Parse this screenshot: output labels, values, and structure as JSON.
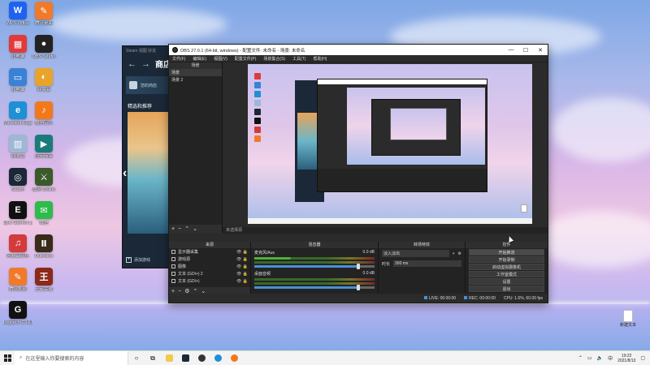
{
  "desktop": {
    "icons": [
      {
        "label": "WPS Office",
        "color": "#1f62f2",
        "glyph": "W"
      },
      {
        "label": "腾讯桌面",
        "color": "#f07a2a",
        "glyph": "✎"
      },
      {
        "label": "此电脑",
        "color": "#e23a3a",
        "glyph": "▦"
      },
      {
        "label": "OBS Studio",
        "color": "#222222",
        "glyph": "●"
      },
      {
        "label": "此电脑",
        "color": "#3a82d6",
        "glyph": "▭"
      },
      {
        "label": "网易云",
        "color": "#e8a42a",
        "glyph": "◐"
      },
      {
        "label": "Microsoft Edge",
        "color": "#1e90d6",
        "glyph": "e"
      },
      {
        "label": "酷狗音乐",
        "color": "#f2791a",
        "glyph": "♪"
      },
      {
        "label": "回收站",
        "color": "#9fb7d6",
        "glyph": "▥"
      },
      {
        "label": "应用商店",
        "color": "#1b7a7a",
        "glyph": "▶"
      },
      {
        "label": "Steam",
        "color": "#1b2838",
        "glyph": "◎"
      },
      {
        "label": "战网 Online",
        "color": "#3a5a2a",
        "glyph": "⚔"
      },
      {
        "label": "Epic Games Launcher",
        "color": "#111111",
        "glyph": "E"
      },
      {
        "label": "微信",
        "color": "#2dbb4b",
        "glyph": "✉"
      },
      {
        "label": "网易云音乐",
        "color": "#d33a3a",
        "glyph": "♫"
      },
      {
        "label": "Outriders",
        "color": "#3a2a1a",
        "glyph": "Ⅱ"
      },
      {
        "label": "腾讯视频",
        "color": "#f07a2a",
        "glyph": "✎"
      },
      {
        "label": "王者荣耀",
        "color": "#8a2a1a",
        "glyph": "王"
      },
      {
        "label": "Logitech G HUB",
        "color": "#111111",
        "glyph": "G"
      }
    ],
    "file_label": "新建文本"
  },
  "steam": {
    "top_text": "Steam  视图  好友",
    "store_label": "商店",
    "banner_text": "您的商店",
    "featured_label": "精选和推荐",
    "add_game_label": "添加游戏"
  },
  "obs": {
    "title": "OBS 27.0.1 (64-bit, windows) - 配置文件: 未命名 - 场景: 未命名",
    "menu": [
      "文件(F)",
      "编辑(E)",
      "视图(V)",
      "配置文件(P)",
      "场景集合(S)",
      "工具(T)",
      "帮助(H)"
    ],
    "scenes_header": "场景",
    "scenes": [
      "场景",
      "场景 2"
    ],
    "source_toolbar": "未选择源",
    "docks": {
      "sources": "来源",
      "mixer": "混音器",
      "transitions": "转场特效",
      "controls": "控件"
    },
    "sources": [
      "显示器采集",
      "游戏源",
      "图像",
      "文本 (GDI+) 2",
      "文本 (GDI+)"
    ],
    "mixer": [
      {
        "name": "麦克风/Aux",
        "level": "0.0 dB"
      },
      {
        "name": "桌面音频",
        "level": "0.0 dB"
      }
    ],
    "transition": {
      "type": "淡入淡出",
      "duration_label": "时长",
      "duration": "300 ms"
    },
    "controls": [
      "开始推流",
      "开始录制",
      "启动虚拟摄像机",
      "工作室模式",
      "设置",
      "退出"
    ],
    "status": {
      "live": "LIVE: 00:00:00",
      "rec": "REC: 00:00:00",
      "cpu": "CPU: 1.6%, 60.00 fps"
    }
  },
  "taskbar": {
    "search_placeholder": "在这里输入你要搜索的内容",
    "time": "19:22",
    "date": "2021/8/13"
  }
}
